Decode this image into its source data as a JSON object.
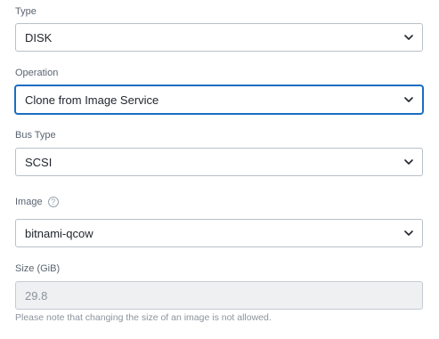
{
  "fields": {
    "type": {
      "label": "Type",
      "value": "DISK"
    },
    "operation": {
      "label": "Operation",
      "value": "Clone from Image Service"
    },
    "bus_type": {
      "label": "Bus Type",
      "value": "SCSI"
    },
    "image": {
      "label": "Image",
      "help_icon": "question-circle-icon",
      "help_glyph": "?",
      "value": "bitnami-qcow"
    },
    "size": {
      "label": "Size (GiB)",
      "value": "29.8",
      "note": "Please note that changing the size of an image is not allowed."
    }
  },
  "colors": {
    "focus_border": "#1b6dc1",
    "border": "#b9c0c8",
    "disabled_bg": "#eef0f2",
    "label_text": "#5a6470",
    "muted_text": "#8b949d"
  }
}
